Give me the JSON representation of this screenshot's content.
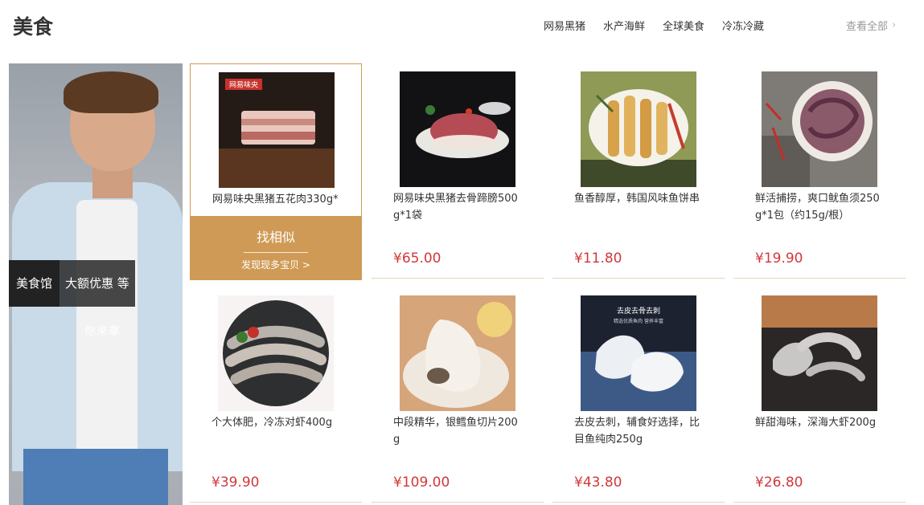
{
  "header": {
    "title": "美食",
    "categories": [
      "网易黑猪",
      "水产海鲜",
      "全球美食",
      "冷冻冷藏"
    ],
    "view_all": "查看全部"
  },
  "banner": {
    "tag_left": "美食馆",
    "tag_right": "大额优惠 等",
    "subtitle": "你来拿"
  },
  "hover_overlay": {
    "title": "找相似",
    "subtitle": "发现现多宝贝 >"
  },
  "products": [
    {
      "name": "网易味央黑猪五花肉330g*1袋",
      "price": "¥"
    },
    {
      "name": "网易味央黑猪去骨蹄膀500g*1袋",
      "price": "¥65.00"
    },
    {
      "name": "鱼香醇厚，韩国风味鱼饼串",
      "price": "¥11.80"
    },
    {
      "name": "鲜活捕捞，爽口鱿鱼须250g*1包（约15g/根）",
      "price": "¥19.90"
    },
    {
      "name": "个大体肥，冷冻对虾400g",
      "price": "¥39.90"
    },
    {
      "name": "中段精华，银鳕鱼切片200g",
      "price": "¥109.00"
    },
    {
      "name": "去皮去刺，辅食好选择，比目鱼纯肉250g",
      "price": "¥43.80"
    },
    {
      "name": "鲜甜海味，深海大虾200g",
      "price": "¥26.80"
    }
  ],
  "image_text": {
    "pork_logo": "网易味央",
    "fish_title": "去皮去骨去刺",
    "fish_sub": "精选优质鱼肉 营养丰富"
  },
  "colors": {
    "accent": "#cf9a55",
    "price": "#d1383a",
    "divider": "#e4d5b7"
  },
  "icons": {
    "view_all": "chevron-right-icon"
  }
}
